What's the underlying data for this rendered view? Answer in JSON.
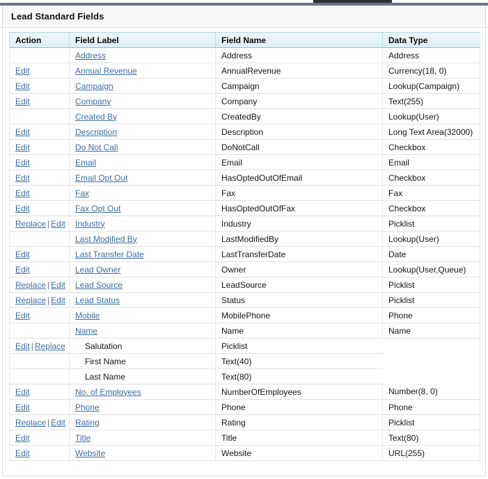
{
  "window": {
    "top_tab_present": true
  },
  "panel": {
    "title": "Lead Standard Fields"
  },
  "table": {
    "columns": [
      "Action",
      "Field Label",
      "Field Name",
      "Data Type"
    ],
    "action_labels": {
      "edit": "Edit",
      "replace": "Replace",
      "separator": "|"
    },
    "rows": [
      {
        "actions": [],
        "label": "Address",
        "link": true,
        "indent": false,
        "name": "Address",
        "type": "Address"
      },
      {
        "actions": [
          "Edit"
        ],
        "label": "Annual Revenue",
        "link": true,
        "indent": false,
        "name": "AnnualRevenue",
        "type": "Currency(18, 0)"
      },
      {
        "actions": [
          "Edit"
        ],
        "label": "Campaign",
        "link": true,
        "indent": false,
        "name": "Campaign",
        "type": "Lookup(Campaign)"
      },
      {
        "actions": [
          "Edit"
        ],
        "label": "Company",
        "link": true,
        "indent": false,
        "name": "Company",
        "type": "Text(255)"
      },
      {
        "actions": [],
        "label": "Created By",
        "link": true,
        "indent": false,
        "name": "CreatedBy",
        "type": "Lookup(User)"
      },
      {
        "actions": [
          "Edit"
        ],
        "label": "Description",
        "link": true,
        "indent": false,
        "name": "Description",
        "type": "Long Text Area(32000)"
      },
      {
        "actions": [
          "Edit"
        ],
        "label": "Do Not Call",
        "link": true,
        "indent": false,
        "name": "DoNotCall",
        "type": "Checkbox"
      },
      {
        "actions": [
          "Edit"
        ],
        "label": "Email",
        "link": true,
        "indent": false,
        "name": "Email",
        "type": "Email"
      },
      {
        "actions": [
          "Edit"
        ],
        "label": "Email Opt Out",
        "link": true,
        "indent": false,
        "name": "HasOptedOutOfEmail",
        "type": "Checkbox"
      },
      {
        "actions": [
          "Edit"
        ],
        "label": "Fax",
        "link": true,
        "indent": false,
        "name": "Fax",
        "type": "Fax"
      },
      {
        "actions": [
          "Edit"
        ],
        "label": "Fax Opt Out",
        "link": true,
        "indent": false,
        "name": "HasOptedOutOfFax",
        "type": "Checkbox"
      },
      {
        "actions": [
          "Replace",
          "Edit"
        ],
        "label": "Industry",
        "link": true,
        "indent": false,
        "name": "Industry",
        "type": "Picklist"
      },
      {
        "actions": [],
        "label": "Last Modified By",
        "link": true,
        "indent": false,
        "name": "LastModifiedBy",
        "type": "Lookup(User)"
      },
      {
        "actions": [
          "Edit"
        ],
        "label": "Last Transfer Date",
        "link": true,
        "indent": false,
        "name": "LastTransferDate",
        "type": "Date"
      },
      {
        "actions": [
          "Edit"
        ],
        "label": "Lead Owner",
        "link": true,
        "indent": false,
        "name": "Owner",
        "type": "Lookup(User,Queue)"
      },
      {
        "actions": [
          "Replace",
          "Edit"
        ],
        "label": "Lead Source",
        "link": true,
        "indent": false,
        "name": "LeadSource",
        "type": "Picklist"
      },
      {
        "actions": [
          "Replace",
          "Edit"
        ],
        "label": "Lead Status",
        "link": true,
        "indent": false,
        "name": "Status",
        "type": "Picklist"
      },
      {
        "actions": [
          "Edit"
        ],
        "label": "Mobile",
        "link": true,
        "indent": false,
        "name": "MobilePhone",
        "type": "Phone"
      },
      {
        "actions": [],
        "label": "Name",
        "link": true,
        "indent": false,
        "name": "Name",
        "type": "Name",
        "name_parent": true
      },
      {
        "actions": [
          "Edit",
          "Replace"
        ],
        "label": "Salutation",
        "link": false,
        "indent": true,
        "name": "Picklist",
        "type": "",
        "subrow": true
      },
      {
        "actions": [],
        "label": "First Name",
        "link": false,
        "indent": true,
        "name": "Text(40)",
        "type": "",
        "subrow": true
      },
      {
        "actions": [],
        "label": "Last Name",
        "link": false,
        "indent": true,
        "name": "Text(80)",
        "type": "",
        "subrow": true
      },
      {
        "actions": [
          "Edit"
        ],
        "label": "No. of Employees",
        "link": true,
        "indent": false,
        "name": "NumberOfEmployees",
        "type": "Number(8, 0)"
      },
      {
        "actions": [
          "Edit"
        ],
        "label": "Phone",
        "link": true,
        "indent": false,
        "name": "Phone",
        "type": "Phone"
      },
      {
        "actions": [
          "Replace",
          "Edit"
        ],
        "label": "Rating",
        "link": true,
        "indent": false,
        "name": "Rating",
        "type": "Picklist"
      },
      {
        "actions": [
          "Edit"
        ],
        "label": "Title",
        "link": true,
        "indent": false,
        "name": "Title",
        "type": "Text(80)"
      },
      {
        "actions": [
          "Edit"
        ],
        "label": "Website",
        "link": true,
        "indent": false,
        "name": "Website",
        "type": "URL(255)"
      }
    ]
  },
  "colors": {
    "link": "#3b6ea5",
    "header_gradient_top": "#eef7fb",
    "header_gradient_bottom": "#d9eef7",
    "top_bar": "#6b7288",
    "panel_bg": "#f7f7f7"
  }
}
